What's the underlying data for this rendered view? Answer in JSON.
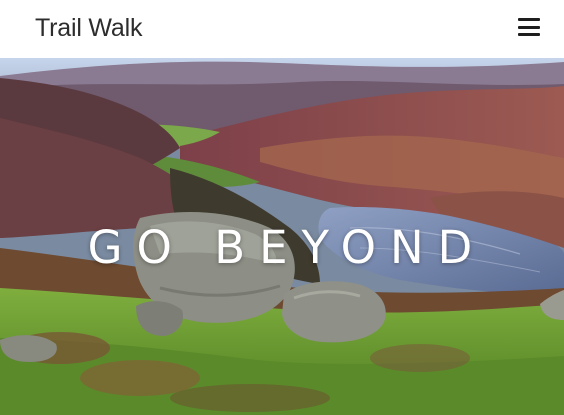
{
  "navbar": {
    "brand": "Trail Walk",
    "menu_icon": "hamburger-menu-icon"
  },
  "hero": {
    "heading": "GO BEYOND",
    "image_description_icon": "landscape-photo",
    "colors": {
      "sky": "#b9c8e0",
      "heather": "#8a4a52",
      "grass": "#6fa23a",
      "lake": "#6d7fa8",
      "rock": "#8d8f86"
    }
  }
}
